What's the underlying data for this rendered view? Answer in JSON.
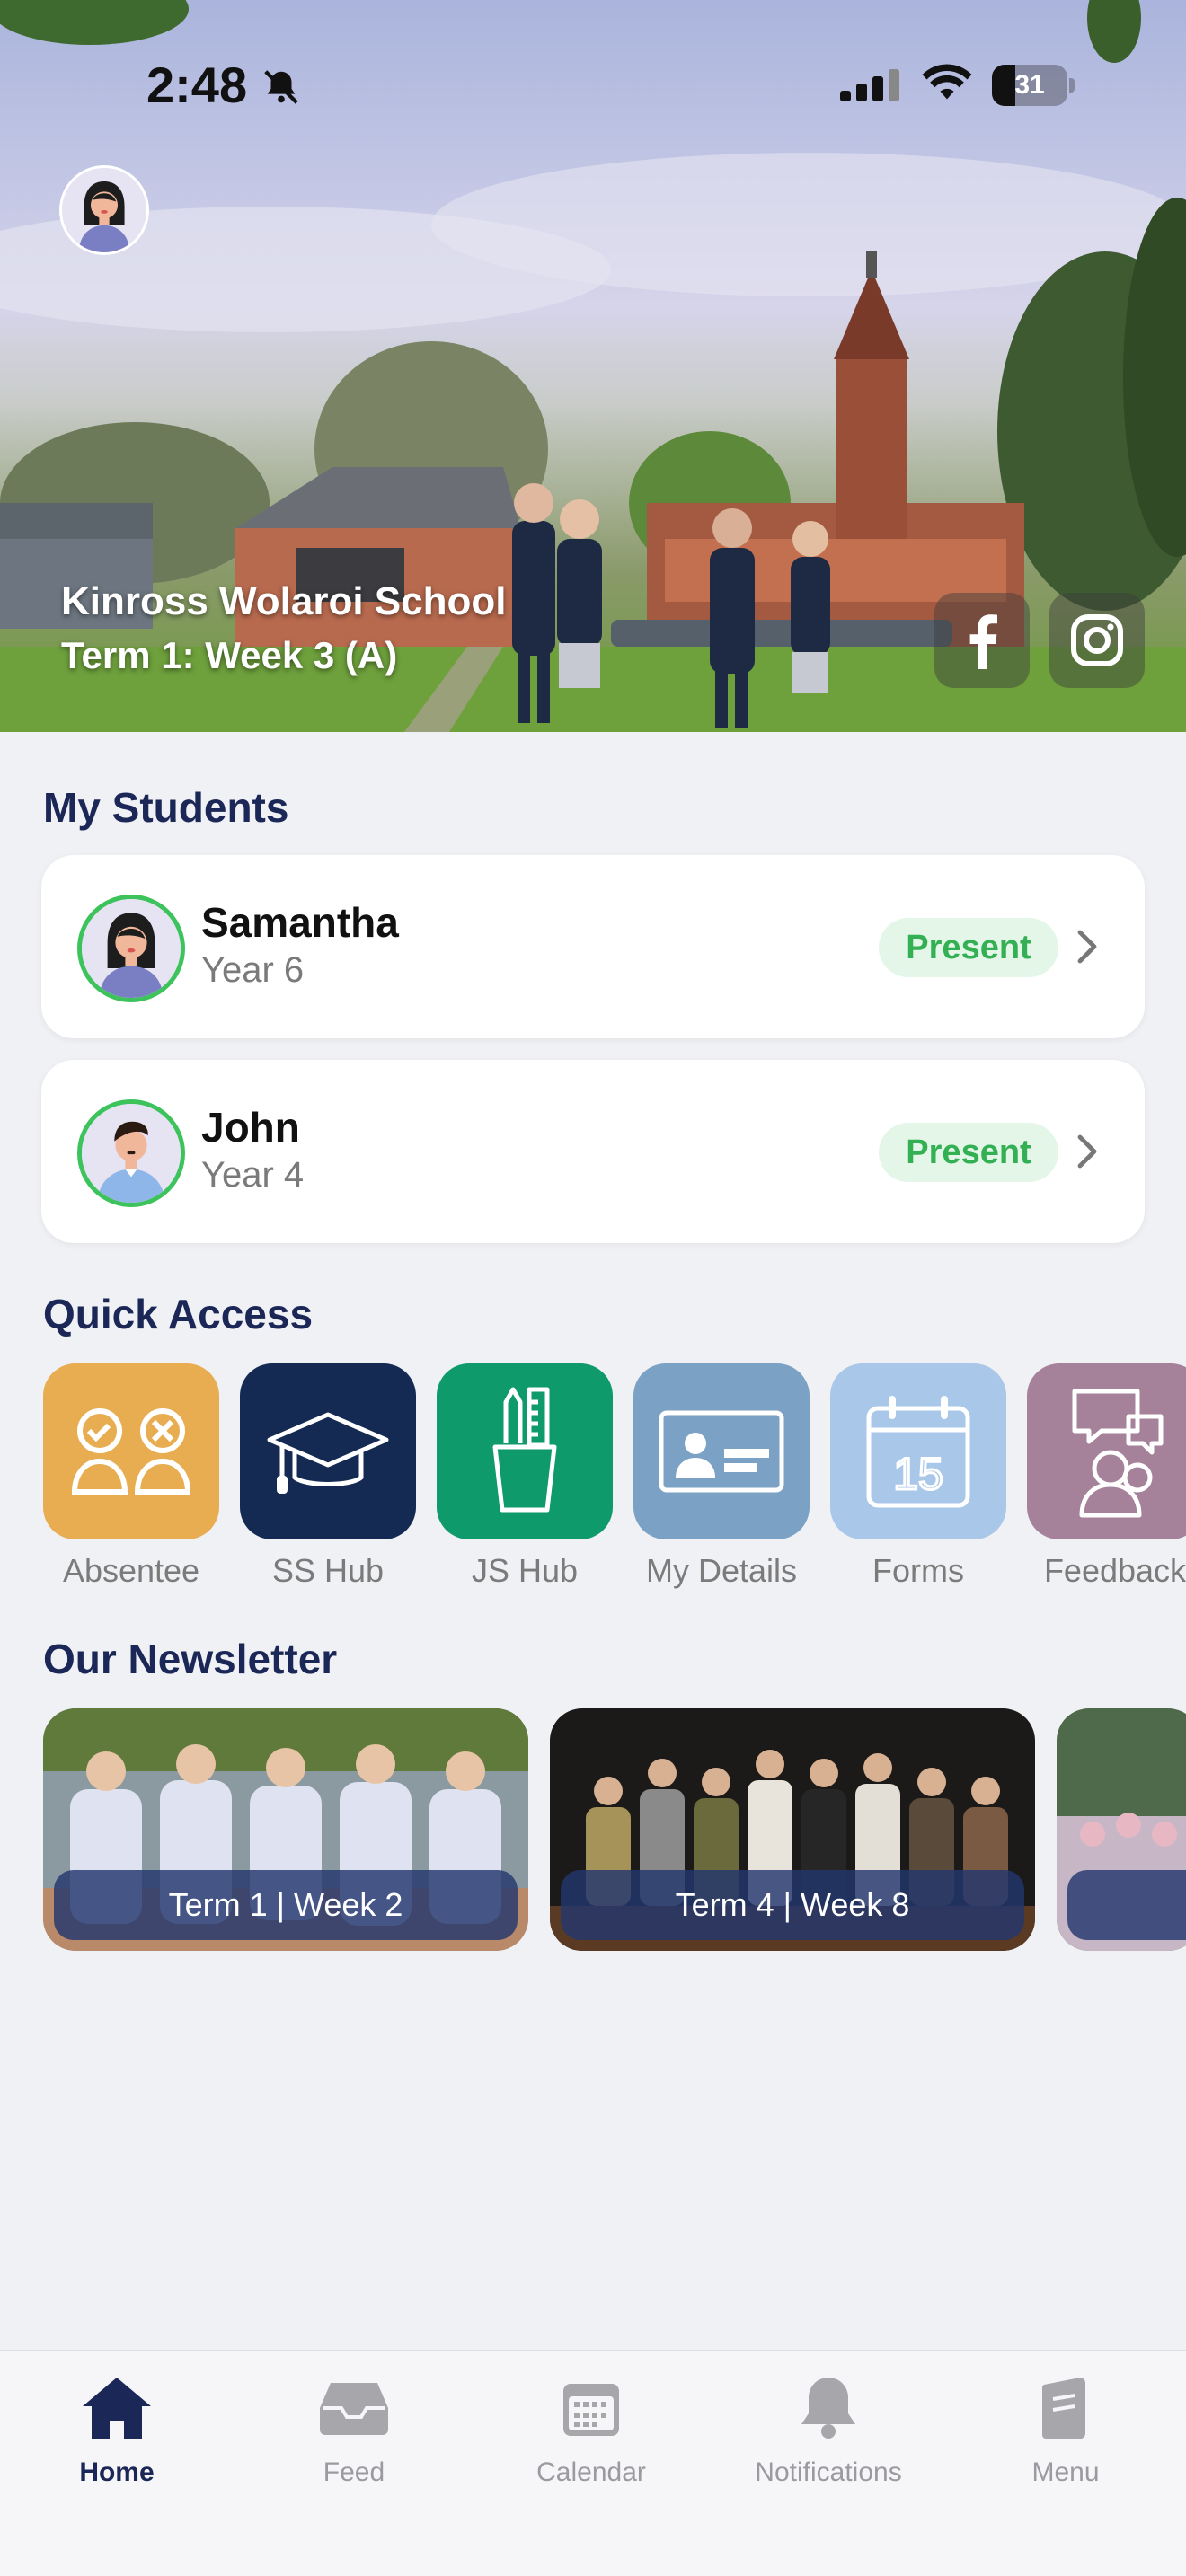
{
  "status_bar": {
    "time": "2:48",
    "battery": "31",
    "battery_level": 0.31
  },
  "hero": {
    "school_name": "Kinross Wolaroi School",
    "term": "Term 1: Week 3 (A)",
    "social": [
      "facebook-icon",
      "instagram-icon"
    ]
  },
  "students": {
    "title": "My Students",
    "items": [
      {
        "name": "Samantha",
        "year": "Year 6",
        "status": "Present"
      },
      {
        "name": "John",
        "year": "Year 4",
        "status": "Present"
      }
    ]
  },
  "quick_access": {
    "title": "Quick Access",
    "items": [
      {
        "label": "Absentee",
        "icon": "absentee-icon",
        "color": "#e8ad50"
      },
      {
        "label": "SS Hub",
        "icon": "graduation-cap-icon",
        "color": "#152a52"
      },
      {
        "label": "JS Hub",
        "icon": "pencil-cup-icon",
        "color": "#0e9a6a"
      },
      {
        "label": "My Details",
        "icon": "id-card-icon",
        "color": "#7ba2c5"
      },
      {
        "label": "Forms",
        "icon": "calendar-15-icon",
        "color": "#a9c7e8"
      },
      {
        "label": "Feedback",
        "icon": "feedback-icon",
        "color": "#a5829a"
      }
    ]
  },
  "newsletter": {
    "title": "Our Newsletter",
    "items": [
      {
        "label": "Term 1 | Week 2"
      },
      {
        "label": "Term 4 | Week 8"
      },
      {
        "label": ""
      }
    ]
  },
  "tabbar": {
    "items": [
      {
        "label": "Home",
        "icon": "home-icon",
        "active": true
      },
      {
        "label": "Feed",
        "icon": "inbox-icon",
        "active": false
      },
      {
        "label": "Calendar",
        "icon": "calendar-icon",
        "active": false
      },
      {
        "label": "Notifications",
        "icon": "bell-icon",
        "active": false
      },
      {
        "label": "Menu",
        "icon": "menu-book-icon",
        "active": false
      }
    ]
  },
  "colors": {
    "accent": "#1b2756",
    "present": "#34b054",
    "present_bg": "#e3f6e8",
    "ring": "#3cc35c"
  }
}
